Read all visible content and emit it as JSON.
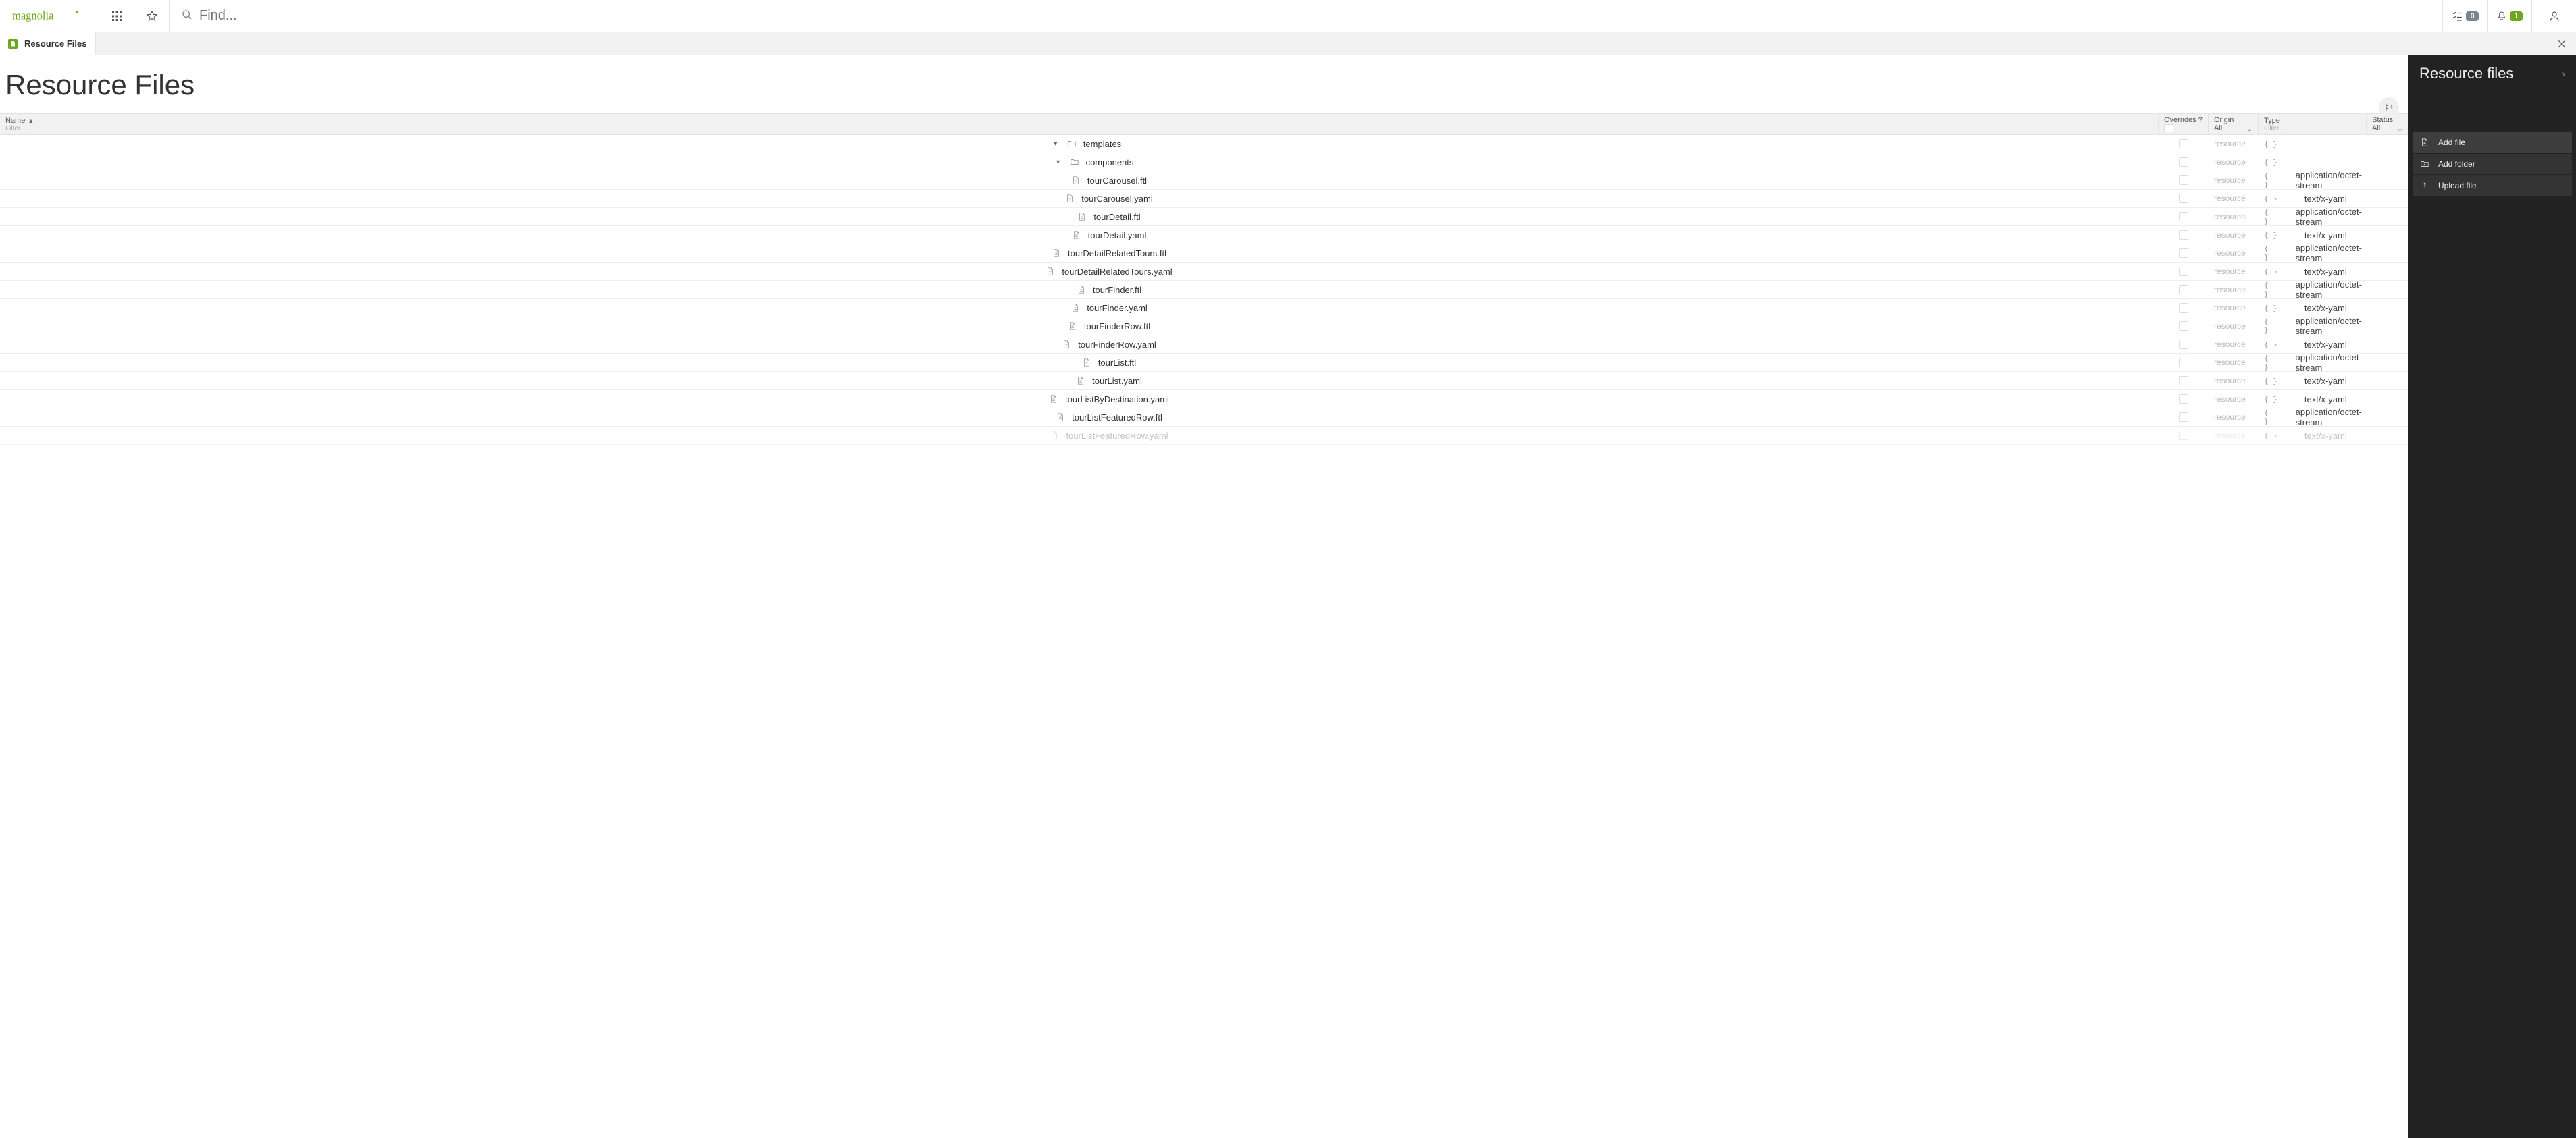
{
  "header": {
    "search_placeholder": "Find...",
    "tasks_count": "0",
    "notifications_count": "1"
  },
  "app_tab": {
    "label": "Resource Files"
  },
  "page": {
    "title": "Resource Files"
  },
  "columns": {
    "name_label": "Name",
    "name_filter_placeholder": "Filter...",
    "overrides_label": "Overrides ?",
    "origin_label": "Origin",
    "origin_value": "All",
    "type_label": "Type",
    "type_filter_placeholder": "Filter...",
    "status_label": "Status",
    "status_value": "All"
  },
  "rows": [
    {
      "level": 0,
      "caret": "down",
      "icon": "folder",
      "name": "templates",
      "overridesCheck": false,
      "origin": "resource",
      "braces": "{ }",
      "mime": ""
    },
    {
      "level": 1,
      "caret": "down",
      "icon": "folder",
      "name": "components",
      "overridesCheck": false,
      "origin": "resource",
      "braces": "{ }",
      "mime": ""
    },
    {
      "level": 2,
      "caret": "",
      "icon": "file",
      "name": "tourCarousel.ftl",
      "overridesCheck": false,
      "origin": "resource",
      "braces": "{ }",
      "mime": "application/octet-stream"
    },
    {
      "level": 2,
      "caret": "",
      "icon": "file",
      "name": "tourCarousel.yaml",
      "overridesCheck": false,
      "origin": "resource",
      "braces": "{ }",
      "mime": "text/x-yaml"
    },
    {
      "level": 2,
      "caret": "",
      "icon": "file",
      "name": "tourDetail.ftl",
      "overridesCheck": false,
      "origin": "resource",
      "braces": "{ }",
      "mime": "application/octet-stream"
    },
    {
      "level": 2,
      "caret": "",
      "icon": "file",
      "name": "tourDetail.yaml",
      "overridesCheck": false,
      "origin": "resource",
      "braces": "{ }",
      "mime": "text/x-yaml"
    },
    {
      "level": 2,
      "caret": "",
      "icon": "file",
      "name": "tourDetailRelatedTours.ftl",
      "overridesCheck": false,
      "origin": "resource",
      "braces": "{ }",
      "mime": "application/octet-stream"
    },
    {
      "level": 2,
      "caret": "",
      "icon": "file",
      "name": "tourDetailRelatedTours.yaml",
      "overridesCheck": false,
      "origin": "resource",
      "braces": "{ }",
      "mime": "text/x-yaml"
    },
    {
      "level": 2,
      "caret": "",
      "icon": "file",
      "name": "tourFinder.ftl",
      "overridesCheck": false,
      "origin": "resource",
      "braces": "{ }",
      "mime": "application/octet-stream"
    },
    {
      "level": 2,
      "caret": "",
      "icon": "file",
      "name": "tourFinder.yaml",
      "overridesCheck": false,
      "origin": "resource",
      "braces": "{ }",
      "mime": "text/x-yaml"
    },
    {
      "level": 2,
      "caret": "",
      "icon": "file",
      "name": "tourFinderRow.ftl",
      "overridesCheck": false,
      "origin": "resource",
      "braces": "{ }",
      "mime": "application/octet-stream"
    },
    {
      "level": 2,
      "caret": "",
      "icon": "file",
      "name": "tourFinderRow.yaml",
      "overridesCheck": false,
      "origin": "resource",
      "braces": "{ }",
      "mime": "text/x-yaml"
    },
    {
      "level": 2,
      "caret": "",
      "icon": "file",
      "name": "tourList.ftl",
      "overridesCheck": false,
      "origin": "resource",
      "braces": "{ }",
      "mime": "application/octet-stream"
    },
    {
      "level": 2,
      "caret": "",
      "icon": "file",
      "name": "tourList.yaml",
      "overridesCheck": false,
      "origin": "resource",
      "braces": "{ }",
      "mime": "text/x-yaml"
    },
    {
      "level": 2,
      "caret": "",
      "icon": "file",
      "name": "tourListByDestination.yaml",
      "overridesCheck": false,
      "origin": "resource",
      "braces": "{ }",
      "mime": "text/x-yaml"
    },
    {
      "level": 2,
      "caret": "",
      "icon": "file",
      "name": "tourListFeaturedRow.ftl",
      "overridesCheck": false,
      "origin": "resource",
      "braces": "{ }",
      "mime": "application/octet-stream"
    },
    {
      "level": 2,
      "caret": "",
      "icon": "file",
      "name": "tourListFeaturedRow.yaml",
      "overridesCheck": false,
      "origin": "resource",
      "braces": "{ }",
      "mime": "text/x-yaml",
      "partial": true
    }
  ],
  "side": {
    "title": "Resource files",
    "actions": [
      {
        "icon": "add-file",
        "label": "Add file"
      },
      {
        "icon": "add-folder",
        "label": "Add folder"
      },
      {
        "icon": "upload",
        "label": "Upload file"
      }
    ]
  }
}
